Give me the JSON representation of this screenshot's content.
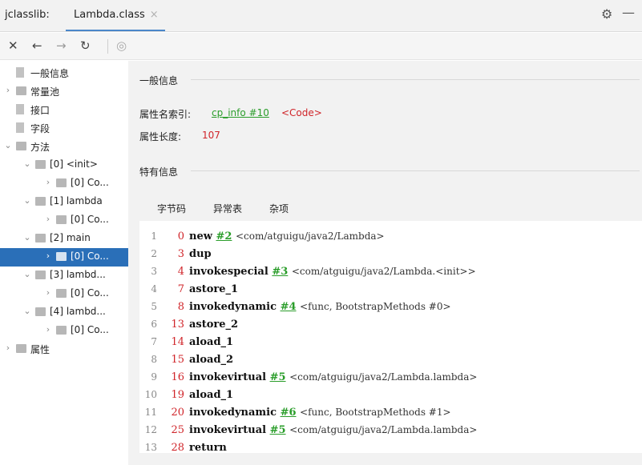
{
  "titlebar": {
    "app_label": "jclasslib:",
    "tab_label": "Lambda.class",
    "close_glyph": "×",
    "gear_glyph": "⚙",
    "minimize_glyph": "—"
  },
  "toolbar": {
    "close_glyph": "✕",
    "back_glyph": "←",
    "forward_glyph": "→",
    "refresh_glyph": "↻",
    "browser_glyph": "◎"
  },
  "tree": [
    {
      "label": "一般信息"
    },
    {
      "label": "常量池"
    },
    {
      "label": "接口"
    },
    {
      "label": "字段"
    },
    {
      "label": "方法"
    },
    {
      "label": "[0] <init>"
    },
    {
      "label": "[0] Co..."
    },
    {
      "label": "[1] lambda"
    },
    {
      "label": "[0] Co..."
    },
    {
      "label": "[2] main"
    },
    {
      "label": "[0] Co..."
    },
    {
      "label": "[3] lambd..."
    },
    {
      "label": "[0] Co..."
    },
    {
      "label": "[4] lambd..."
    },
    {
      "label": "[0] Co..."
    },
    {
      "label": "属性"
    }
  ],
  "general": {
    "section_title": "一般信息",
    "name_index_label": "属性名索引:",
    "name_index_link": "cp_info #10",
    "name_index_value": "<Code>",
    "length_label": "属性长度:",
    "length_value": "107"
  },
  "specific": {
    "section_title": "特有信息",
    "tabs": [
      "字节码",
      "异常表",
      "杂项"
    ]
  },
  "bytecode": [
    {
      "ln": "1",
      "off": "0",
      "op": "new",
      "ref": "#2",
      "cmt": "<com/atguigu/java2/Lambda>"
    },
    {
      "ln": "2",
      "off": "3",
      "op": "dup",
      "ref": "",
      "cmt": ""
    },
    {
      "ln": "3",
      "off": "4",
      "op": "invokespecial",
      "ref": "#3",
      "cmt": "<com/atguigu/java2/Lambda.<init>>"
    },
    {
      "ln": "4",
      "off": "7",
      "op": "astore_1",
      "ref": "",
      "cmt": ""
    },
    {
      "ln": "5",
      "off": "8",
      "op": "invokedynamic",
      "ref": "#4",
      "cmt": "<func, BootstrapMethods #0>"
    },
    {
      "ln": "6",
      "off": "13",
      "op": "astore_2",
      "ref": "",
      "cmt": ""
    },
    {
      "ln": "7",
      "off": "14",
      "op": "aload_1",
      "ref": "",
      "cmt": ""
    },
    {
      "ln": "8",
      "off": "15",
      "op": "aload_2",
      "ref": "",
      "cmt": ""
    },
    {
      "ln": "9",
      "off": "16",
      "op": "invokevirtual",
      "ref": "#5",
      "cmt": "<com/atguigu/java2/Lambda.lambda>"
    },
    {
      "ln": "10",
      "off": "19",
      "op": "aload_1",
      "ref": "",
      "cmt": ""
    },
    {
      "ln": "11",
      "off": "20",
      "op": "invokedynamic",
      "ref": "#6",
      "cmt": "<func, BootstrapMethods #1>"
    },
    {
      "ln": "12",
      "off": "25",
      "op": "invokevirtual",
      "ref": "#5",
      "cmt": "<com/atguigu/java2/Lambda.lambda>"
    },
    {
      "ln": "13",
      "off": "28",
      "op": "return",
      "ref": "",
      "cmt": ""
    }
  ]
}
